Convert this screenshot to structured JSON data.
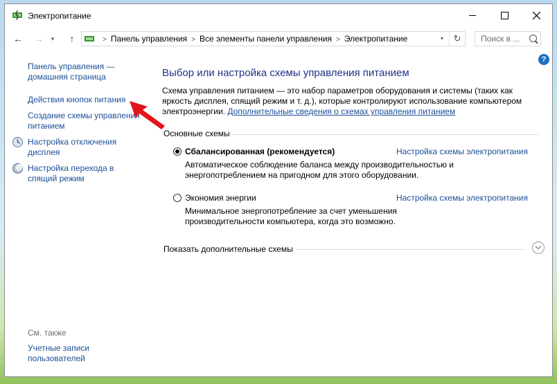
{
  "window": {
    "title": "Электропитание"
  },
  "nav": {
    "breadcrumbs": [
      "Панель управления",
      "Все элементы панели управления",
      "Электропитание"
    ],
    "search_placeholder": "Поиск в ..."
  },
  "sidebar": {
    "links": [
      "Панель управления — домашняя страница",
      "Действия кнопок питания",
      "Создание схемы управления питанием",
      "Настройка отключения дисплея",
      "Настройка перехода в спящий режим"
    ],
    "see_also_label": "См. также",
    "see_also_links": [
      "Учетные записи пользователей"
    ]
  },
  "main": {
    "title": "Выбор или настройка схемы управления питанием",
    "description": "Схема управления питанием — это набор параметров оборудования и системы (таких как яркость дисплея, спящий режим и т. д.), которые контролируют использование компьютером электроэнергии.",
    "description_link": "Дополнительные сведения о схемах управления питанием",
    "group_label": "Основные схемы",
    "plans": [
      {
        "name": "Сбалансированная (рекомендуется)",
        "selected": true,
        "link": "Настройка схемы электропитания",
        "description": "Автоматическое соблюдение баланса между производительностью и энергопотреблением на пригодном для этого оборудовании."
      },
      {
        "name": "Экономия энергии",
        "selected": false,
        "link": "Настройка схемы электропитания",
        "description": "Минимальное энергопотребление за счет уменьшения производительности компьютера, когда это возможно."
      }
    ],
    "show_more_label": "Показать дополнительные схемы"
  },
  "colors": {
    "link": "#1a4e97",
    "title": "#1e3287",
    "accent_arrow": "#e3151a",
    "help": "#1f6fc4"
  },
  "icons": [
    "power-options-icon",
    "back-arrow-icon",
    "forward-arrow-icon",
    "recent-dropdown-icon",
    "up-arrow-icon",
    "refresh-icon",
    "search-icon",
    "help-icon",
    "display-icon",
    "sleep-icon",
    "chevron-down-icon"
  ]
}
